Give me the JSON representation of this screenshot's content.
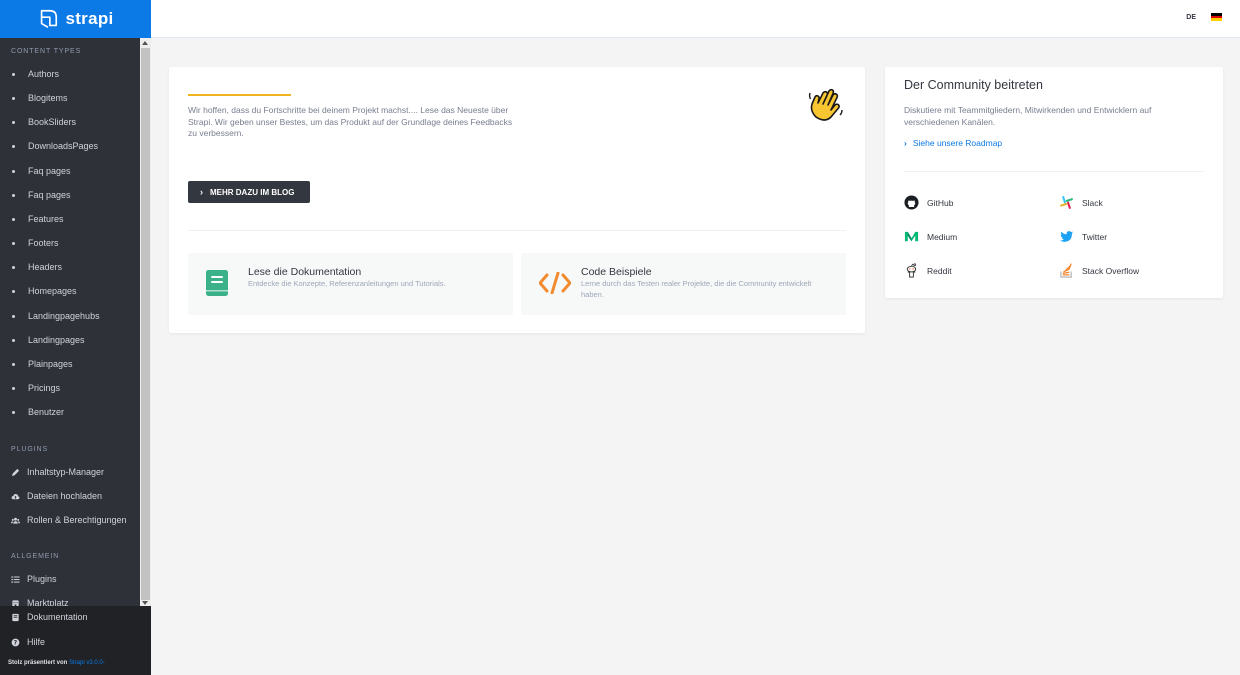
{
  "brand": {
    "name": "strapi"
  },
  "sidebar": {
    "content_types_title": "Content Types",
    "content_types": [
      "Authors",
      "Blogitems",
      "BookSliders",
      "DownloadsPages",
      "Faq pages",
      "Faq pages",
      "Features",
      "Footers",
      "Headers",
      "Homepages",
      "Landingpagehubs",
      "Landingpages",
      "Plainpages",
      "Pricings",
      "Benutzer"
    ],
    "plugins_title": "Plugins",
    "plugins": [
      {
        "label": "Inhaltstyp-Manager",
        "icon": "pencil-icon"
      },
      {
        "label": "Dateien hochladen",
        "icon": "cloud-upload-icon"
      },
      {
        "label": "Rollen & Berechtigungen",
        "icon": "users-icon"
      }
    ],
    "general_title": "Allgemein",
    "general": [
      {
        "label": "Plugins",
        "icon": "list-icon"
      },
      {
        "label": "Marktplatz",
        "icon": "shop-icon"
      }
    ],
    "footer_links": [
      {
        "label": "Dokumentation",
        "icon": "book-icon"
      },
      {
        "label": "Hilfe",
        "icon": "question-icon"
      }
    ],
    "powered_text": "Stolz präsentiert von",
    "powered_link": "Strapi v3.0.0-"
  },
  "header": {
    "language": "DE"
  },
  "main": {
    "intro": "Wir hoffen, dass du Fortschritte bei deinem Projekt machst.... Lese das Neueste über Strapi. Wir geben unser Bestes, um das Produkt auf der Grundlage deines Feedbacks zu verbessern.",
    "blog_button": "MEHR DAZU IM BLOG",
    "docs_title": "Lese die Dokumentation",
    "docs_sub": "Entdecke die Konzepte, Referenzanleitungen und Tutorials.",
    "code_title": "Code Beispiele",
    "code_sub": "Lerne durch das Testen realer Projekte, die die Community entwickelt haben."
  },
  "community": {
    "title": "Der Community beitreten",
    "desc": "Diskutiere mit Teammitgliedern, Mitwirkenden und Entwicklern auf verschiedenen Kanälen.",
    "roadmap": "Siehe unsere Roadmap",
    "links": [
      {
        "label": "GitHub",
        "icon": "github-icon"
      },
      {
        "label": "Slack",
        "icon": "slack-icon"
      },
      {
        "label": "Medium",
        "icon": "medium-icon"
      },
      {
        "label": "Twitter",
        "icon": "twitter-icon"
      },
      {
        "label": "Reddit",
        "icon": "reddit-icon"
      },
      {
        "label": "Stack Overflow",
        "icon": "stackoverflow-icon"
      }
    ]
  },
  "colors": {
    "brand_blue": "#0b7ae6",
    "sidebar": "#2e3138",
    "accent": "#f0b41f",
    "docs_green": "#3bb18a",
    "code_orange": "#f28a2e"
  }
}
